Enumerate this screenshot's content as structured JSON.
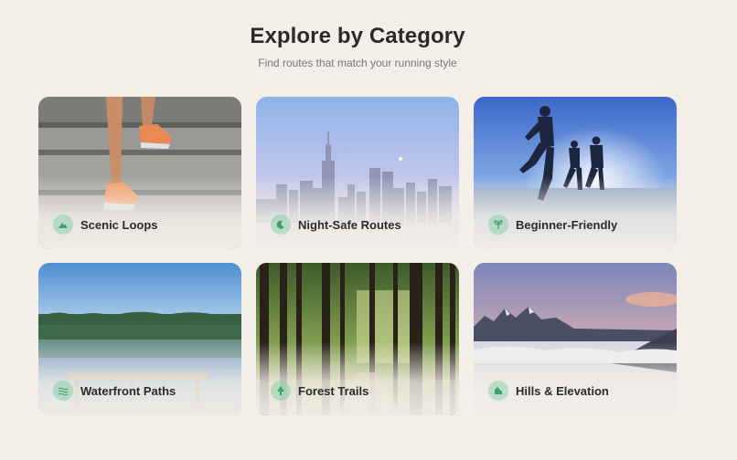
{
  "header": {
    "title": "Explore by Category",
    "subtitle": "Find routes that match your running style"
  },
  "categories": [
    {
      "label": "Scenic Loops",
      "icon": "mountain-icon"
    },
    {
      "label": "Night-Safe Routes",
      "icon": "moon-icon"
    },
    {
      "label": "Beginner-Friendly",
      "icon": "sprout-icon"
    },
    {
      "label": "Waterfront Paths",
      "icon": "waves-icon"
    },
    {
      "label": "Forest Trails",
      "icon": "tree-icon"
    },
    {
      "label": "Hills & Elevation",
      "icon": "hill-icon"
    }
  ],
  "colors": {
    "background": "#f3eee8",
    "icon_badge": "#78cda0",
    "title": "#2a2a2a"
  }
}
